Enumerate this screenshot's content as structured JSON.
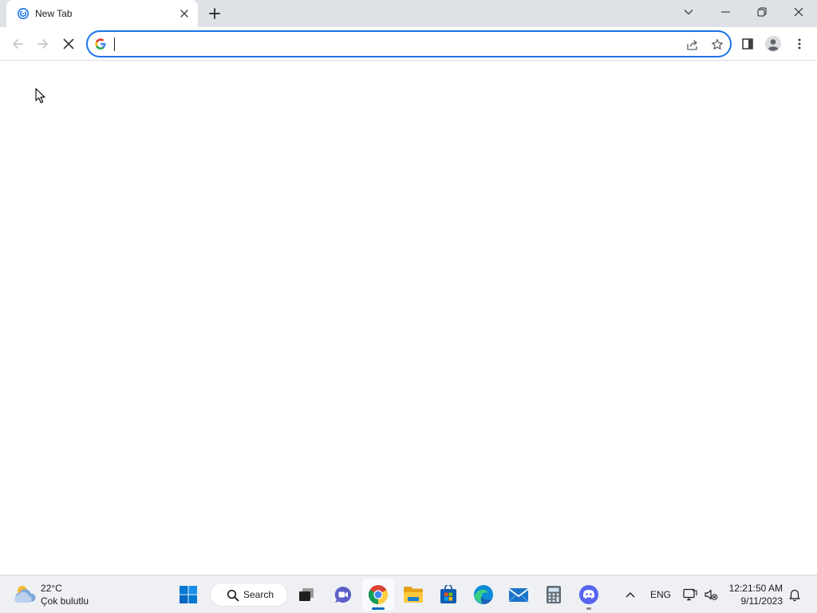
{
  "browser": {
    "tab": {
      "title": "New Tab"
    },
    "omnibox": {
      "value": "",
      "placeholder": ""
    }
  },
  "taskbar": {
    "weather": {
      "temp": "22°C",
      "condition": "Çok bulutlu"
    },
    "search": {
      "label": "Search"
    },
    "apps": [
      {
        "name": "start-button",
        "icon": "windows-logo-icon"
      },
      {
        "name": "task-view",
        "icon": "task-view-icon"
      },
      {
        "name": "chat",
        "icon": "chat-camera-icon"
      },
      {
        "name": "chrome",
        "icon": "chrome-icon",
        "active": true
      },
      {
        "name": "file-explorer",
        "icon": "folder-icon"
      },
      {
        "name": "microsoft-store",
        "icon": "store-icon"
      },
      {
        "name": "edge",
        "icon": "edge-icon"
      },
      {
        "name": "mail",
        "icon": "mail-icon"
      },
      {
        "name": "calculator",
        "icon": "calculator-icon"
      },
      {
        "name": "discord",
        "icon": "discord-icon",
        "running": true
      }
    ],
    "tray": {
      "language": "ENG",
      "time": "12:21:50 AM",
      "date": "9/11/2023"
    }
  },
  "colors": {
    "accent": "#1a73e8",
    "tabstrip": "#dee1e6",
    "taskbar": "#eef0f4",
    "chrome_indicator": "#0067c0"
  }
}
